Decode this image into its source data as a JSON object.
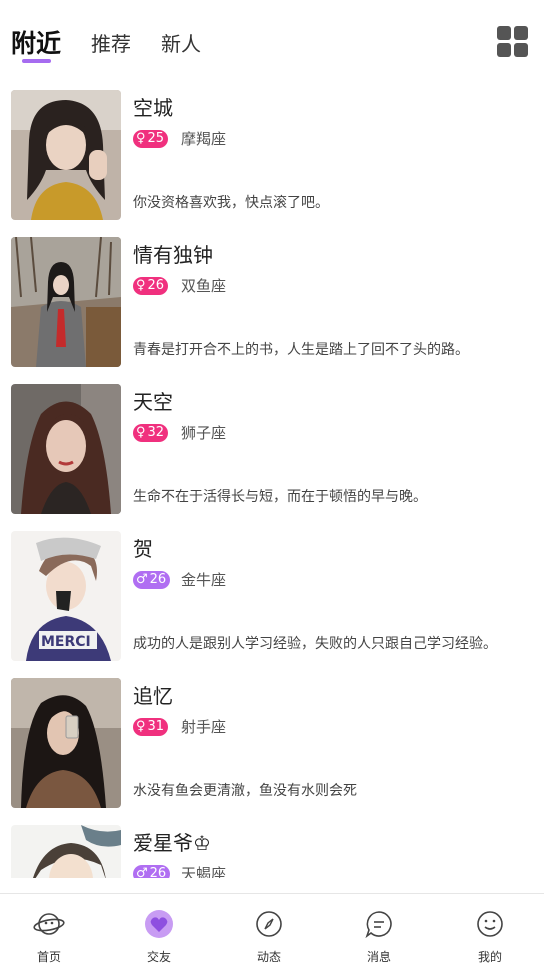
{
  "header": {
    "tabs": [
      {
        "label": "附近",
        "active": true
      },
      {
        "label": "推荐",
        "active": false
      },
      {
        "label": "新人",
        "active": false
      }
    ],
    "grid_icon": "grid-view-icon"
  },
  "users": [
    {
      "name": "空城",
      "gender": "female",
      "gender_symbol": "♀",
      "age": "25",
      "zodiac": "摩羯座",
      "bio": "你没资格喜欢我，快点滚了吧。"
    },
    {
      "name": "情有独钟",
      "gender": "female",
      "gender_symbol": "♀",
      "age": "26",
      "zodiac": "双鱼座",
      "bio": "青春是打开合不上的书，人生是踏上了回不了头的路。"
    },
    {
      "name": "天空",
      "gender": "female",
      "gender_symbol": "♀",
      "age": "32",
      "zodiac": "狮子座",
      "bio": "生命不在于活得长与短，而在于顿悟的早与晚。"
    },
    {
      "name": "贺",
      "gender": "male",
      "gender_symbol": "♂",
      "age": "26",
      "zodiac": "金牛座",
      "bio": "成功的人是跟别人学习经验，失败的人只跟自己学习经验。"
    },
    {
      "name": "追忆",
      "gender": "female",
      "gender_symbol": "♀",
      "age": "31",
      "zodiac": "射手座",
      "bio": "水没有鱼会更清澈，鱼没有水则会死"
    },
    {
      "name": "爱星爷♔",
      "gender": "male",
      "gender_symbol": "♂",
      "age": "26",
      "zodiac": "天蝎座",
      "bio": ""
    }
  ],
  "bottom_nav": [
    {
      "label": "首页",
      "icon": "planet-icon",
      "active": false
    },
    {
      "label": "交友",
      "icon": "heart-bubble-icon",
      "active": true
    },
    {
      "label": "动态",
      "icon": "compass-icon",
      "active": false
    },
    {
      "label": "消息",
      "icon": "message-icon",
      "active": false
    },
    {
      "label": "我的",
      "icon": "smiley-icon",
      "active": false
    }
  ],
  "colors": {
    "accent": "#a66cf0",
    "female_badge": "#f0307e",
    "male_badge": "#b06ef2"
  }
}
